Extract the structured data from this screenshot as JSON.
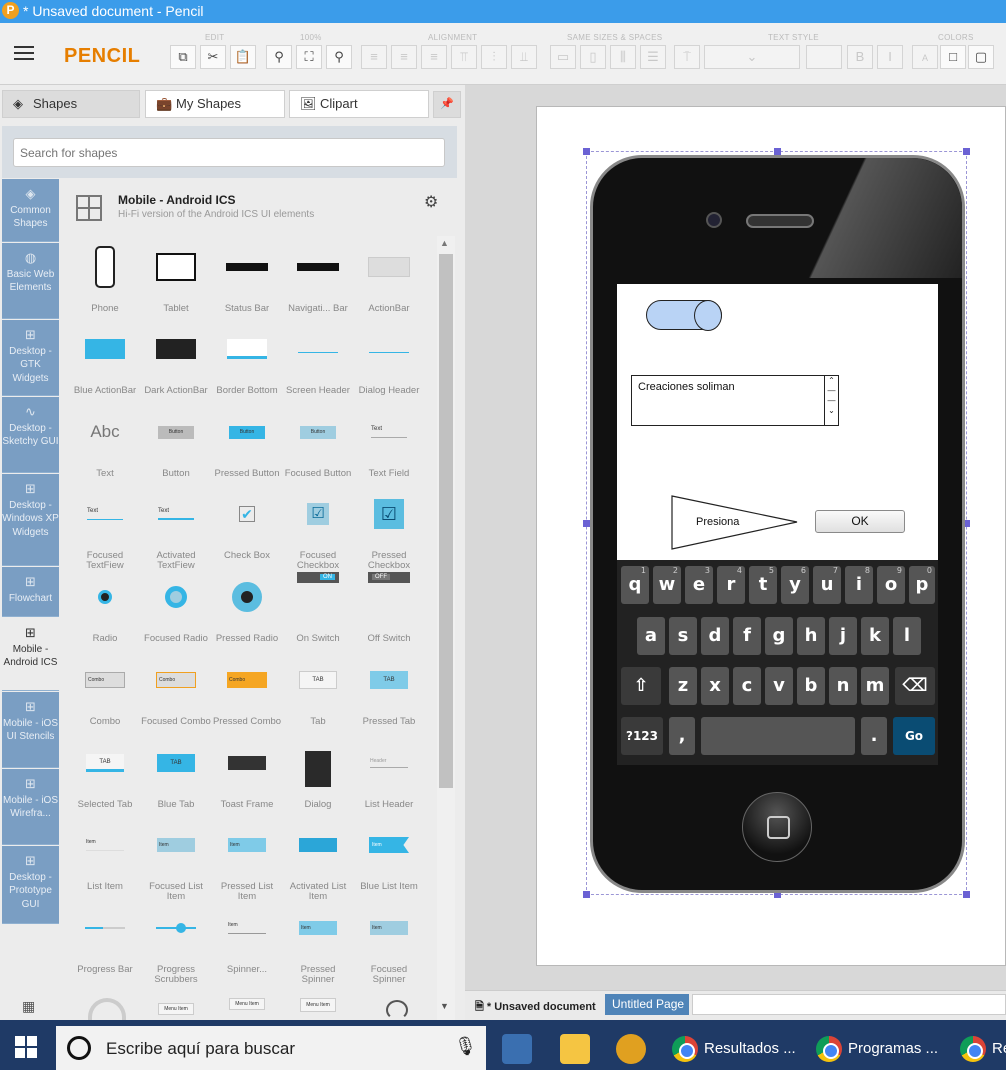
{
  "window": {
    "title": "* Unsaved document - Pencil",
    "app_icon": "P"
  },
  "toolbar": {
    "logo": "PENCIL",
    "groups": [
      "EDIT",
      "100%",
      "ALIGNMENT",
      "SAME SIZES & SPACES",
      "TEXT STYLE",
      "COLORS"
    ]
  },
  "sidebar": {
    "tabs": [
      {
        "label": "Shapes"
      },
      {
        "label": "My Shapes"
      },
      {
        "label": "Clipart"
      }
    ],
    "search_placeholder": "Search for shapes",
    "categories": [
      {
        "label": "Common Shapes",
        "icon": "layers-icon"
      },
      {
        "label": "Basic Web Elements",
        "icon": "globe-icon"
      },
      {
        "label": "Desktop - GTK Widgets",
        "icon": "grid-icon"
      },
      {
        "label": "Desktop - Sketchy GUI",
        "icon": "squiggle-icon"
      },
      {
        "label": "Desktop - Windows XP Widgets",
        "icon": "grid-icon"
      },
      {
        "label": "Flowchart",
        "icon": "grid-icon"
      },
      {
        "label": "Mobile - Android ICS",
        "icon": "grid-icon",
        "active": true
      },
      {
        "label": "Mobile - iOS UI Stencils",
        "icon": "grid-icon"
      },
      {
        "label": "Mobile - iOS Wirefra...",
        "icon": "grid-icon"
      },
      {
        "label": "Desktop - Prototype GUI",
        "icon": "grid-icon"
      }
    ],
    "collection": {
      "title": "Mobile - Android ICS",
      "description": "Hi-Fi version of the Android ICS UI elements"
    },
    "shapes": [
      [
        "Phone",
        "Tablet",
        "Status Bar",
        "Navigati... Bar",
        "ActionBar"
      ],
      [
        "Blue ActionBar",
        "Dark ActionBar",
        "Border Bottom",
        "Screen Header",
        "Dialog Header"
      ],
      [
        "Text",
        "Button",
        "Pressed Button",
        "Focused Button",
        "Text Field"
      ],
      [
        "Focused TextFiew",
        "Activated TextFiew",
        "Check Box",
        "Focused Checkbox",
        "Pressed Checkbox"
      ],
      [
        "Radio",
        "Focused Radio",
        "Pressed Radio",
        "On Switch",
        "Off Switch"
      ],
      [
        "Combo",
        "Focused Combo",
        "Pressed Combo",
        "Tab",
        "Pressed Tab"
      ],
      [
        "Selected Tab",
        "Blue Tab",
        "Toast Frame",
        "Dialog",
        "List Header"
      ],
      [
        "List Item",
        "Focused List Item",
        "Pressed List Item",
        "Activated List Item",
        "Blue List Item"
      ],
      [
        "Progress Bar",
        "Progress Scrubbers",
        "Spinner...",
        "Pressed Spinner",
        "Focused Spinner"
      ]
    ],
    "preview_text": {
      "abc": "Abc",
      "button": "Button",
      "text": "Text",
      "on": "ON",
      "off": "OFF",
      "combo": "Combo",
      "tab": "TAB",
      "header": "Header",
      "item": "Item",
      "menu": "Menu Item"
    }
  },
  "canvas": {
    "mock": {
      "textarea_text": "Creaciones soliman",
      "triangle_label": "Presiona",
      "ok_label": "OK"
    },
    "keyboard": {
      "row1": [
        [
          "q",
          "1"
        ],
        [
          "w",
          "2"
        ],
        [
          "e",
          "3"
        ],
        [
          "r",
          "4"
        ],
        [
          "t",
          "5"
        ],
        [
          "y",
          "6"
        ],
        [
          "u",
          "7"
        ],
        [
          "i",
          "8"
        ],
        [
          "o",
          "9"
        ],
        [
          "p",
          "0"
        ]
      ],
      "row2": [
        "a",
        "s",
        "d",
        "f",
        "g",
        "h",
        "j",
        "k",
        "l"
      ],
      "row3": [
        "z",
        "x",
        "c",
        "v",
        "b",
        "n",
        "m"
      ],
      "sym": "?123",
      "comma": ",",
      "period": ".",
      "go": "Go"
    }
  },
  "pagebar": {
    "doc": "* Unsaved document",
    "page": "Untitled Page"
  },
  "taskbar": {
    "search": "Escribe aquí para buscar",
    "apps": [
      {
        "label": "Resultados ..."
      },
      {
        "label": "Programas ..."
      },
      {
        "label": "Re"
      }
    ]
  }
}
